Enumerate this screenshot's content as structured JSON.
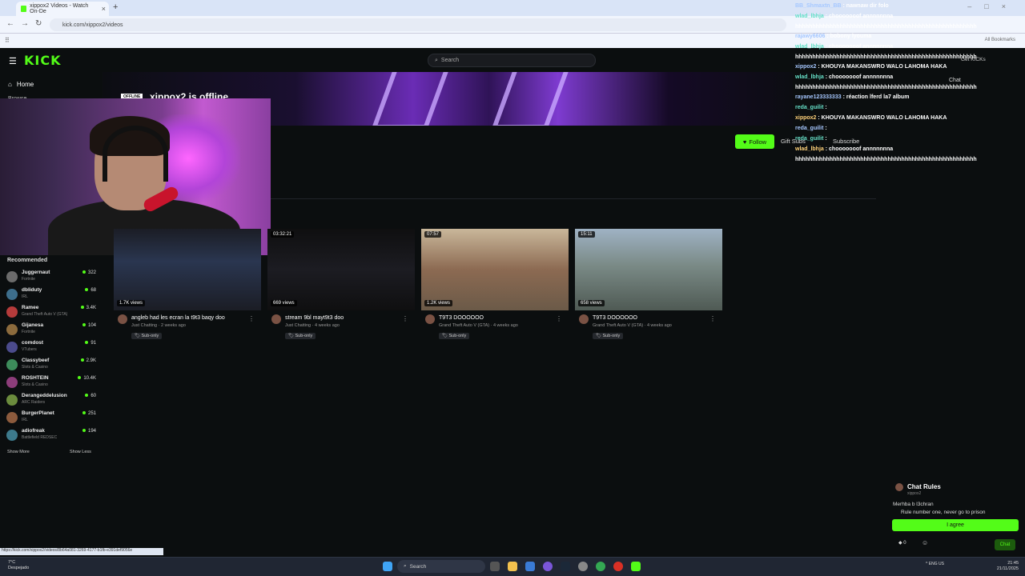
{
  "browser": {
    "tab_title": "xippox2 Videos - Watch On-De",
    "url": "kick.com/xippox2/videos",
    "new_tab_icon": "plus-icon",
    "all_bookmarks": "All Bookmarks"
  },
  "header": {
    "logo": "KICK",
    "search_placeholder": "Search"
  },
  "sidebar": {
    "home_label": "Home",
    "browse_label": "Browse",
    "recommended_title": "Recommended",
    "items": [
      {
        "name": "Juggernaut",
        "category": "Fortnite",
        "viewers": "322"
      },
      {
        "name": "dbliduty",
        "category": "IRL",
        "viewers": "68"
      },
      {
        "name": "Ramee",
        "category": "Grand Theft Auto V (GTA)",
        "viewers": "3.4K"
      },
      {
        "name": "Gijanesa",
        "category": "Fortnite",
        "viewers": "104"
      },
      {
        "name": "comdost",
        "category": "VTubers",
        "viewers": "91"
      },
      {
        "name": "Classybeef",
        "category": "Slots & Casino",
        "viewers": "2.9K"
      },
      {
        "name": "ROSHTEIN",
        "category": "Slots & Casino",
        "viewers": "10.4K"
      },
      {
        "name": "Derangeddelusion",
        "category": "ARC Raiders",
        "viewers": "60"
      },
      {
        "name": "BurgerPlanet",
        "category": "IRL",
        "viewers": "251"
      },
      {
        "name": "adiofreak",
        "category": "Battlefield REDSEC",
        "viewers": "194"
      }
    ],
    "show_more": "Show More",
    "show_less": "Show Less"
  },
  "channel": {
    "offline_badge": "OFFLINE",
    "offline_title": "xippox2 is offline",
    "follow_label": "Follow",
    "gift_label": "Gift Subs",
    "subscribe_label": "Subscribe"
  },
  "videos": [
    {
      "duration": "",
      "views": "1.7K views",
      "title": "angleb had les ecran la t9t3 baqy doo",
      "category": "Just Chatting",
      "age": "2 weeks ago",
      "badge": "Sub-only"
    },
    {
      "duration": "03:32:21",
      "views": "669 views",
      "title": "stream 9bl mayt9t3 doo",
      "category": "Just Chatting",
      "age": "4 weeks ago",
      "badge": "Sub-only"
    },
    {
      "duration": "07:57",
      "views": "1.2K views",
      "title": "T9T3 DOOOOOO",
      "category": "Grand Theft Auto V (GTA)",
      "age": "4 weeks ago",
      "badge": "Sub-only"
    },
    {
      "duration": "15:11",
      "views": "658 views",
      "title": "T9T3 DOOOOOO",
      "category": "Grand Theft Auto V (GTA)",
      "age": "4 weeks ago",
      "badge": "Sub-only"
    }
  ],
  "chat_overlay": [
    {
      "user": "BB_Shmaxtn_BB",
      "text": ": nawnaw dir folo"
    },
    {
      "user": "wlad_lbhja",
      "text": ": chooooooof annnnnnna"
    },
    {
      "user": "",
      "text": "hhhhhhhhhhhhhhhhhhhhhhhhhhhhhhhhhhhhhhhhhhhhhhhhhhhhh"
    },
    {
      "user": "rajawy6606",
      "text": ": bobony lyouma"
    },
    {
      "user": "wlad_lbhja",
      "text": ": chooooooof annnnnnna"
    },
    {
      "user": "",
      "text": "hhhhhhhhhhhhhhhhhhhhhhhhhhhhhhhhhhhhhhhhhhhhhhhhhhhhh"
    },
    {
      "user": "xippox2",
      "text": ": KHOUYA MAKANSWRO WALO LAHOMA HAKA"
    },
    {
      "user": "wlad_lbhja",
      "text": ": chooooooof annnnnnna"
    },
    {
      "user": "",
      "text": "hhhhhhhhhhhhhhhhhhhhhhhhhhhhhhhhhhhhhhhhhhhhhhhhhhhhh"
    },
    {
      "user": "rayane123333333",
      "text": ": réaction lferd la7 album"
    },
    {
      "user": "reda_guilit",
      "text": ":"
    },
    {
      "user": "xippox2",
      "text": ": KHOUYA MAKANSWRO WALO LAHOMA HAKA"
    },
    {
      "user": "reda_guilit",
      "text": ":"
    },
    {
      "user": "reda_guilit",
      "text": ":"
    },
    {
      "user": "wlad_lbhja",
      "text": ": chooooooof annnnnnna"
    },
    {
      "user": "",
      "text": "hhhhhhhhhhhhhhhhhhhhhhhhhhhhhhhhhhhhhhhhhhhhhhhhhhhhh"
    }
  ],
  "chat_panel": {
    "get_kicks": "Get KICKs",
    "chat_label": "Chat"
  },
  "chat_rules": {
    "title": "Chat Rules",
    "channel": "xippox2",
    "rule1": "Merhba b l3chran",
    "rule2": "Rule number one, never go to prison",
    "agree_label": "I agree",
    "points": "0",
    "chat_button": "Chat"
  },
  "status_url": "https://kick.com/xippox2/videos/8b64a081-3269-4177-b1fb-e391def9056e",
  "taskbar": {
    "weather_temp": "7°C",
    "weather_desc": "Despejado",
    "search_label": "Search",
    "lang": "ENG",
    "region": "US",
    "time": "21:45",
    "date": "21/11/2025"
  },
  "colors": {
    "kick_green": "#53fc18",
    "background": "#0b0e0f"
  }
}
